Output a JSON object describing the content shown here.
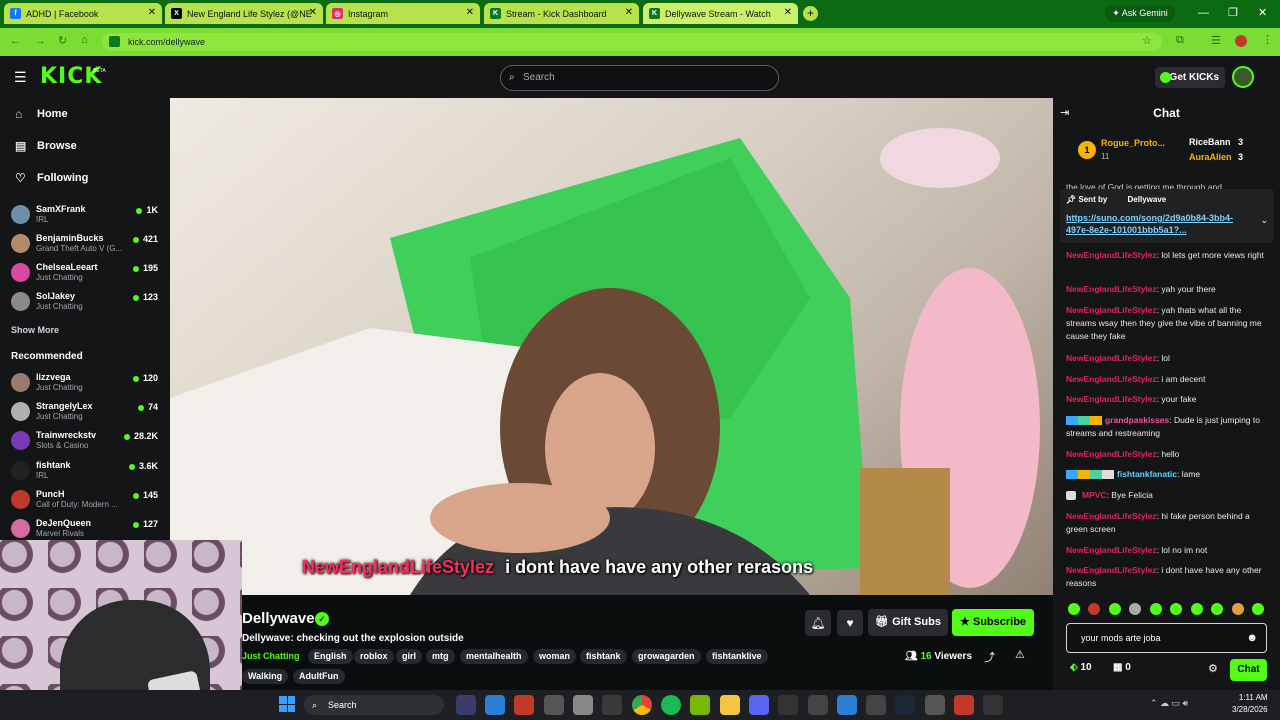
{
  "browser": {
    "tabs": [
      {
        "label": "ADHD | Facebook",
        "icon": "facebook-icon",
        "color": "#1877f2"
      },
      {
        "label": "New England Life Stylez (@NE",
        "icon": "x-icon",
        "color": "#000000"
      },
      {
        "label": "Instagram",
        "icon": "instagram-icon",
        "color": "#e1306c"
      },
      {
        "label": "Stream - Kick Dashboard",
        "icon": "kick-icon",
        "color": "#53fc18"
      },
      {
        "label": "Dellywave Stream - Watch",
        "icon": "kick-icon",
        "color": "#53fc18"
      }
    ],
    "ask_gemini": "Ask Gemini",
    "url": "kick.com/dellywave"
  },
  "header": {
    "logo": "KICK",
    "logo_badge": "BETA",
    "search_placeholder": "Search",
    "get_kicks": "Get KICKs"
  },
  "sidebar": {
    "nav": [
      {
        "label": "Home",
        "icon": "home-icon"
      },
      {
        "label": "Browse",
        "icon": "browse-icon"
      },
      {
        "label": "Following",
        "icon": "heart-icon"
      }
    ],
    "following": [
      {
        "name": "SamXFrank",
        "game": "IRL",
        "viewers": "1K",
        "color": "#6f8fa8"
      },
      {
        "name": "BenjaminBucks",
        "game": "Grand Theft Auto V (G...",
        "viewers": "421",
        "color": "#b58a6a"
      },
      {
        "name": "ChelseaLeeart",
        "game": "Just Chatting",
        "viewers": "195",
        "color": "#d84aa0"
      },
      {
        "name": "SolJakey",
        "game": "Just Chatting",
        "viewers": "123",
        "color": "#8a8a8a"
      }
    ],
    "show_more": "Show More",
    "recommended_title": "Recommended",
    "recommended": [
      {
        "name": "lizzvega",
        "game": "Just Chatting",
        "viewers": "120",
        "color": "#9a7a6a"
      },
      {
        "name": "StrangelyLex",
        "game": "Just Chatting",
        "viewers": "74",
        "color": "#b0b0b0"
      },
      {
        "name": "Trainwreckstv",
        "game": "Slots & Casino",
        "viewers": "28.2K",
        "color": "#7a3ab5"
      },
      {
        "name": "fishtank",
        "game": "IRL",
        "viewers": "3.6K",
        "color": "#222222"
      },
      {
        "name": "PuncH",
        "game": "Call of Duty: Modern ...",
        "viewers": "145",
        "color": "#c0392b"
      },
      {
        "name": "DeJenQueen",
        "game": "Marvel Rivals",
        "viewers": "127",
        "color": "#d46aa0"
      }
    ]
  },
  "video": {
    "caption_user": "NewEnglandLifeStylez",
    "caption_text": "i dont have have any other rerasons"
  },
  "stream": {
    "streamer": "Dellywave",
    "title": "Dellywave: checking out the explosion outside",
    "category": "Just Chatting",
    "tags": [
      "English",
      "roblox",
      "girl",
      "mtg",
      "mentalhealth",
      "woman",
      "fishtank",
      "growagarden",
      "fishtanklive",
      "Walking",
      "AdultFun"
    ],
    "gift_subs": "Gift Subs",
    "subscribe": "Subscribe",
    "viewers_count": "16",
    "viewers_label": "Viewers"
  },
  "chat": {
    "title": "Chat",
    "leaderboard": [
      {
        "rank": "1",
        "name": "Rogue_Proto...",
        "count": "11"
      },
      {
        "name": "RiceBann",
        "count": "3"
      },
      {
        "name": "AuraAlien",
        "count": "3"
      }
    ],
    "overflow_line": "the love of God is getting me through and",
    "pinned": {
      "sent_by": "Sent by",
      "author": "Dellywave",
      "link": "https://suno.com/song/2d9a0b84-3bb4-497e-8e2e-101001bbb5a1?..."
    },
    "messages": [
      {
        "user": "NewEnglandLifeStylez",
        "text": ": lol lets get more views right"
      },
      {
        "user": "NewEnglandLifeStylez",
        "text": ": yah your there"
      },
      {
        "user": "NewEnglandLifeStylez",
        "text": ": yah thats what all the streams wsay then they give the vibe of banning me cause they fake"
      },
      {
        "user": "NewEnglandLifeStylez",
        "text": ": lol"
      },
      {
        "user": "NewEnglandLifeStylez",
        "text": ": i am decent"
      },
      {
        "user": "NewEnglandLifeStylez",
        "text": ": your fake"
      },
      {
        "user": "grandpaskisses",
        "text": ": Dude is just jumping to streams and restreaming"
      },
      {
        "user": "NewEnglandLifeStylez",
        "text": ": hello"
      },
      {
        "user": "fishtankfanatic",
        "text": ": lame"
      },
      {
        "user": "MPVC",
        "text": ": Bye Felicia"
      },
      {
        "user": "NewEnglandLifeStylez",
        "text": ": hi fake person behind a green screen"
      },
      {
        "user": "NewEnglandLifeStylez",
        "text": ": lol no im not"
      },
      {
        "user": "NewEnglandLifeStylez",
        "text": ": i dont have have any other reasons"
      }
    ],
    "input_value": "your mods arte joba",
    "kicks_count": "10",
    "points_count": "0",
    "send": "Chat"
  },
  "taskbar": {
    "search": "Search",
    "time": "1:11 AM",
    "date": "3/28/2026"
  }
}
